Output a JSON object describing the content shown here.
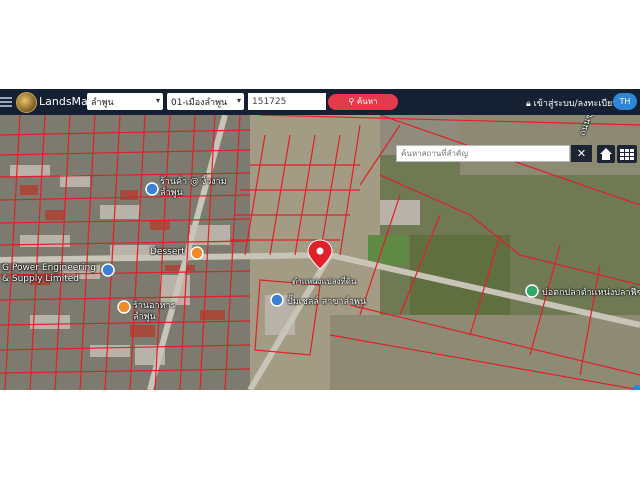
{
  "app": {
    "brand": "LandsMaps"
  },
  "search": {
    "province": "ลำพูน",
    "district": "01-เมืองลำพูน",
    "parcel_number": "151725",
    "search_label": "ค้นหา"
  },
  "user": {
    "login_label": "เข้าสู่ระบบ/ลงทะเบียน",
    "lang": "TH"
  },
  "map": {
    "place_search_placeholder": "ค้นหาสถานที่สำคัญ",
    "close_label": "✕",
    "labels": {
      "road": "ถนนซุปเปอร์ไฮเวย์ลำพูน",
      "shop_store": "ร้านค้า @ งิ้วงาม ลำพูน",
      "dessert": "Dessert",
      "company": "G Power Engineering & Supply Limited",
      "restaurant": "ร้านอาหาร ลำพูน",
      "parcel_label": "ตำแหน่งแปลงที่ดิน",
      "gas_station": "ปั๊มเชลล์ สาขาลำพูน",
      "fish_pond": "บ่อตกปลาตำเเหน่งปลาฟีซ"
    },
    "colors": {
      "parcel_line": "#e0202a",
      "pin": "#e0202a",
      "navbar": "#152033",
      "search_btn": "#e53a4b"
    }
  }
}
